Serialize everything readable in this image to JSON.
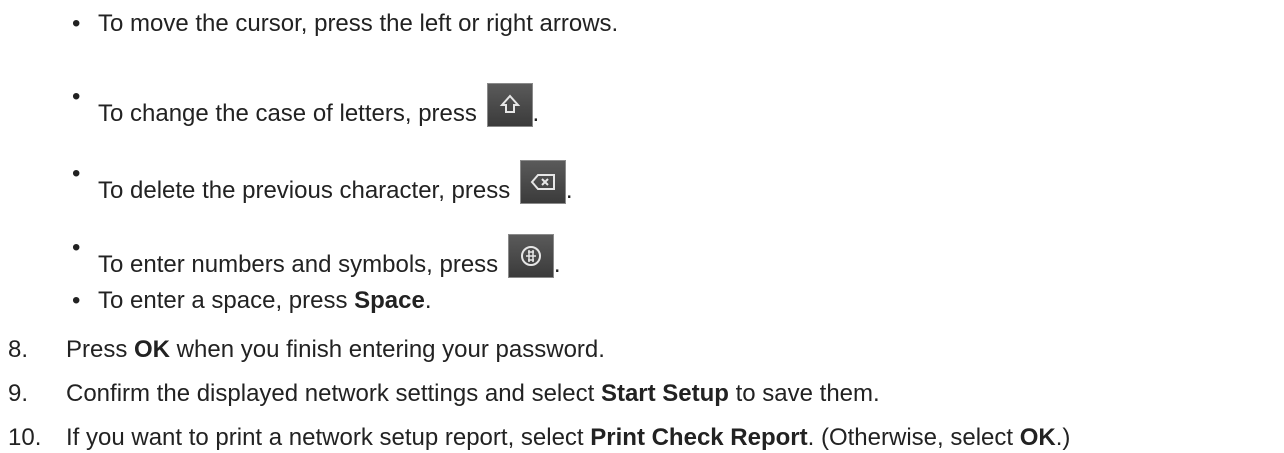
{
  "bullets": [
    {
      "text": "To move the cursor, press the left or right arrows."
    },
    {
      "text": "To change the case of letters, press ",
      "icon": "shift-icon",
      "after": "."
    },
    {
      "text": "To delete the previous character, press ",
      "icon": "backspace-icon",
      "after": "."
    },
    {
      "text": "To enter numbers and symbols, press ",
      "icon": "symbols-icon",
      "after": "."
    },
    {
      "text": "To enter a space, press ",
      "bold": "Space",
      "after": "."
    }
  ],
  "bullet_char": "•",
  "steps": [
    {
      "num": "8.",
      "pre": "Press ",
      "bold": "OK",
      "post": " when you finish entering your password."
    },
    {
      "num": "9.",
      "pre": "Confirm the displayed network settings and select ",
      "bold": "Start Setup",
      "post": " to save them."
    },
    {
      "num": "10.",
      "pre": "If you want to print a network setup report, select ",
      "bold": "Print Check Report",
      "mid": ". (Otherwise, select ",
      "bold2": "OK",
      "post": ".)"
    }
  ]
}
